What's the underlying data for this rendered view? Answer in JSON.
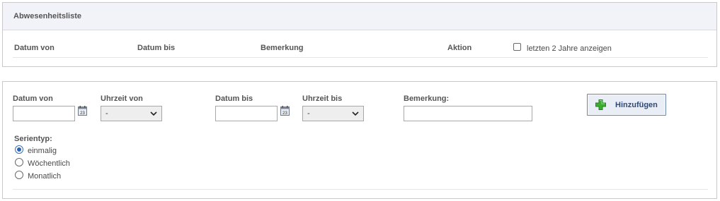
{
  "absence_list": {
    "title": "Abwesenheitsliste",
    "columns": {
      "date_from": "Datum von",
      "date_to": "Datum bis",
      "remark": "Bemerkung",
      "action": "Aktion"
    },
    "show_two_years": {
      "label": "letzten 2 Jahre anzeigen",
      "checked": false
    }
  },
  "form": {
    "date_from": {
      "label": "Datum von",
      "value": ""
    },
    "time_from": {
      "label": "Uhrzeit von",
      "selected": "-"
    },
    "date_to": {
      "label": "Datum bis",
      "value": ""
    },
    "time_to": {
      "label": "Uhrzeit bis",
      "selected": "-"
    },
    "remark": {
      "label": "Bemerkung:",
      "value": ""
    },
    "add_button": {
      "label": "Hinzufügen"
    },
    "series": {
      "label": "Serientyp:",
      "options": [
        "einmalig",
        "Wöchentlich",
        "Monatlich"
      ],
      "selected": "einmalig"
    },
    "icons": {
      "calendar": "calendar-icon",
      "add": "plus-icon",
      "dropdown": "chevron-down-icon"
    },
    "colors": {
      "add_plus": "#3cae2f",
      "button_text": "#2f4a73",
      "radio_selected": "#2a64b6"
    }
  }
}
